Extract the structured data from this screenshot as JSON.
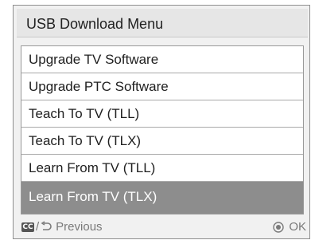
{
  "menu": {
    "title": "USB Download Menu",
    "items": [
      {
        "label": "Upgrade TV Software",
        "selected": false
      },
      {
        "label": "Upgrade PTC Software",
        "selected": false
      },
      {
        "label": "Teach To TV (TLL)",
        "selected": false
      },
      {
        "label": "Teach To TV (TLX)",
        "selected": false
      },
      {
        "label": "Learn From TV (TLL)",
        "selected": false
      },
      {
        "label": "Learn From TV (TLX)",
        "selected": true
      }
    ]
  },
  "footer": {
    "cc_icon_text": "CC",
    "cc_icon": "cc-icon",
    "slash": "/",
    "back_icon": "back-arrow-icon",
    "previous_label": "Previous",
    "ok_icon": "ok-circle-icon",
    "ok_label": "OK"
  },
  "colors": {
    "selected_background": "#8d8d8d",
    "selected_text": "#ffffff",
    "frame_border": "#8f8f8f",
    "background": "#f1f1f1"
  }
}
